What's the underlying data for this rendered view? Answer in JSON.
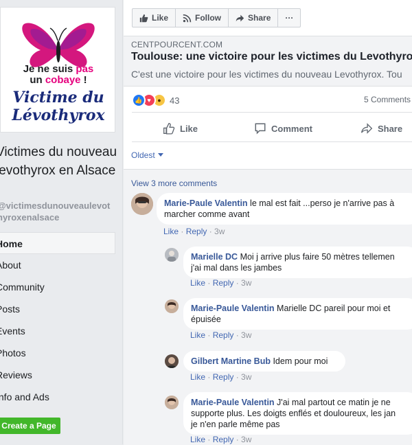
{
  "sidebar": {
    "logo": {
      "line1_a": "Je ne suis ",
      "line1_b": "pas",
      "line2_a": "un ",
      "line2_b": "cobaye",
      "line2_c": " !",
      "line3": "Victime du",
      "line4": "Lévothyrox"
    },
    "page_name": "Victimes du nouveau levothyrox en Alsace",
    "page_handle": "@victimesdunouveaulevothyroxenalsace",
    "nav": [
      "Home",
      "About",
      "Community",
      "Posts",
      "Events",
      "Photos",
      "Reviews",
      "Info and Ads"
    ],
    "create_page": "Create a Page"
  },
  "actionbar": {
    "like": "Like",
    "follow": "Follow",
    "share": "Share",
    "more": "···"
  },
  "link_card": {
    "domain": "CENTPOURCENT.COM",
    "title": "Toulouse: une victoire pour les victimes du Levothyrox",
    "description": "C'est une victoire pour les victimes du nouveau Levothyrox. Tou"
  },
  "stats": {
    "reaction_count": "43",
    "comments": "5 Comments"
  },
  "actions": {
    "like": "Like",
    "comment": "Comment",
    "share": "Share"
  },
  "order": "Oldest",
  "view_more": "View 3 more comments",
  "comments": [
    {
      "author": "Marie-Paule Valentin",
      "text1": " le mal est fait ...perso je n'arrive pas à",
      "text2": "marcher comme avant",
      "like": "Like",
      "reply": "Reply",
      "age": "3w"
    },
    {
      "author": "Marielle DC",
      "text1": " Moi j arrive plus faire 50 mètres tellemen",
      "text2": "j'ai mal dans les jambes",
      "like": "Like",
      "reply": "Reply",
      "age": "3w"
    },
    {
      "author": "Marie-Paule Valentin",
      "text1": " Marielle DC pareil pour moi et",
      "text2": "épuisée",
      "like": "Like",
      "reply": "Reply",
      "age": "3w"
    },
    {
      "author": "Gilbert Martine Bub",
      "text1": " Idem pour moi",
      "text2": "",
      "like": "Like",
      "reply": "Reply",
      "age": "3w"
    },
    {
      "author": "Marie-Paule Valentin",
      "text1": " J'ai mal partout ce matin je ne",
      "text2": "supporte plus. Les doigts enflés et douloureux, les jan",
      "text3": "je n'en parle même pas",
      "like": "Like",
      "reply": "Reply",
      "age": "3w"
    }
  ],
  "colors": {
    "accent": "#4267b2",
    "link": "#385898",
    "green": "#42b72a",
    "logo_pink": "#e6007e"
  }
}
